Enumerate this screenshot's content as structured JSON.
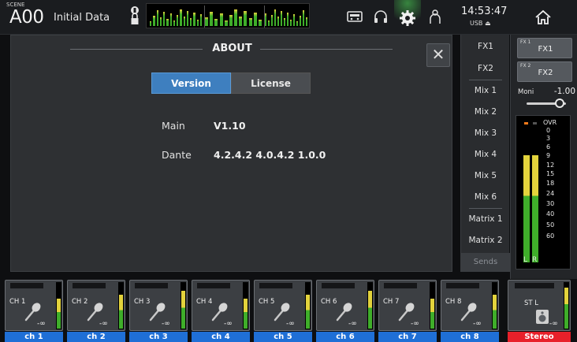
{
  "header": {
    "scene_tag": "SCENE",
    "scene_number": "A00",
    "scene_name": "Initial Data",
    "time": "14:53:47",
    "usb_label": "USB ⏏"
  },
  "about": {
    "title": "ABOUT",
    "close_label": "✕",
    "tabs": [
      {
        "label": "Version",
        "active": true
      },
      {
        "label": "License",
        "active": false
      }
    ],
    "info": [
      {
        "label": "Main",
        "value": "V1.10"
      },
      {
        "label": "Dante",
        "value": "4.2.4.2 4.0.4.2 1.0.0"
      }
    ]
  },
  "sends": {
    "items": [
      "FX1",
      "FX2",
      "Mix 1",
      "Mix 2",
      "Mix 3",
      "Mix 4",
      "Mix 5",
      "Mix 6",
      "Matrix 1",
      "Matrix 2"
    ],
    "tab_label": "Sends"
  },
  "stereo_panel": {
    "fx_buttons": [
      {
        "tiny": "FX 1",
        "label": "FX1"
      },
      {
        "tiny": "FX 2",
        "label": "FX2"
      }
    ],
    "moni_label": "Moni",
    "moni_value": "-1.00",
    "meter_scale": [
      "OVR",
      "0",
      "3",
      "6",
      "9",
      "12",
      "15",
      "18",
      "24",
      "30",
      "40",
      "50",
      "60"
    ],
    "meter_left_label": "L",
    "meter_right_label": "R",
    "meter_levels": {
      "left": 0.79,
      "right": 0.79
    }
  },
  "channels": [
    {
      "name": "CH 1",
      "label": "ch 1",
      "value": "-∞"
    },
    {
      "name": "CH 2",
      "label": "ch 2",
      "value": "-∞"
    },
    {
      "name": "CH 3",
      "label": "ch 3",
      "value": "-∞"
    },
    {
      "name": "CH 4",
      "label": "ch 4",
      "value": "-∞"
    },
    {
      "name": "CH 5",
      "label": "ch 5",
      "value": "-∞"
    },
    {
      "name": "CH 6",
      "label": "ch 6",
      "value": "-∞"
    },
    {
      "name": "CH 7",
      "label": "ch 7",
      "value": "-∞"
    },
    {
      "name": "CH 8",
      "label": "ch 8",
      "value": "-∞"
    }
  ],
  "stereo_channel": {
    "name": "ST L",
    "label": "Stereo",
    "value": "-∞"
  },
  "colors": {
    "accent": "#3e7fbf",
    "channel_label": "#1f6fd6",
    "stereo_label": "#e8202a",
    "meter_green": "#3fae2a",
    "meter_yellow": "#e3d33c"
  },
  "icons": [
    "lock-icon",
    "recorder-icon",
    "headphones-icon",
    "gear-icon",
    "user-icon",
    "home-icon",
    "microphone-icon",
    "speaker-icon"
  ]
}
